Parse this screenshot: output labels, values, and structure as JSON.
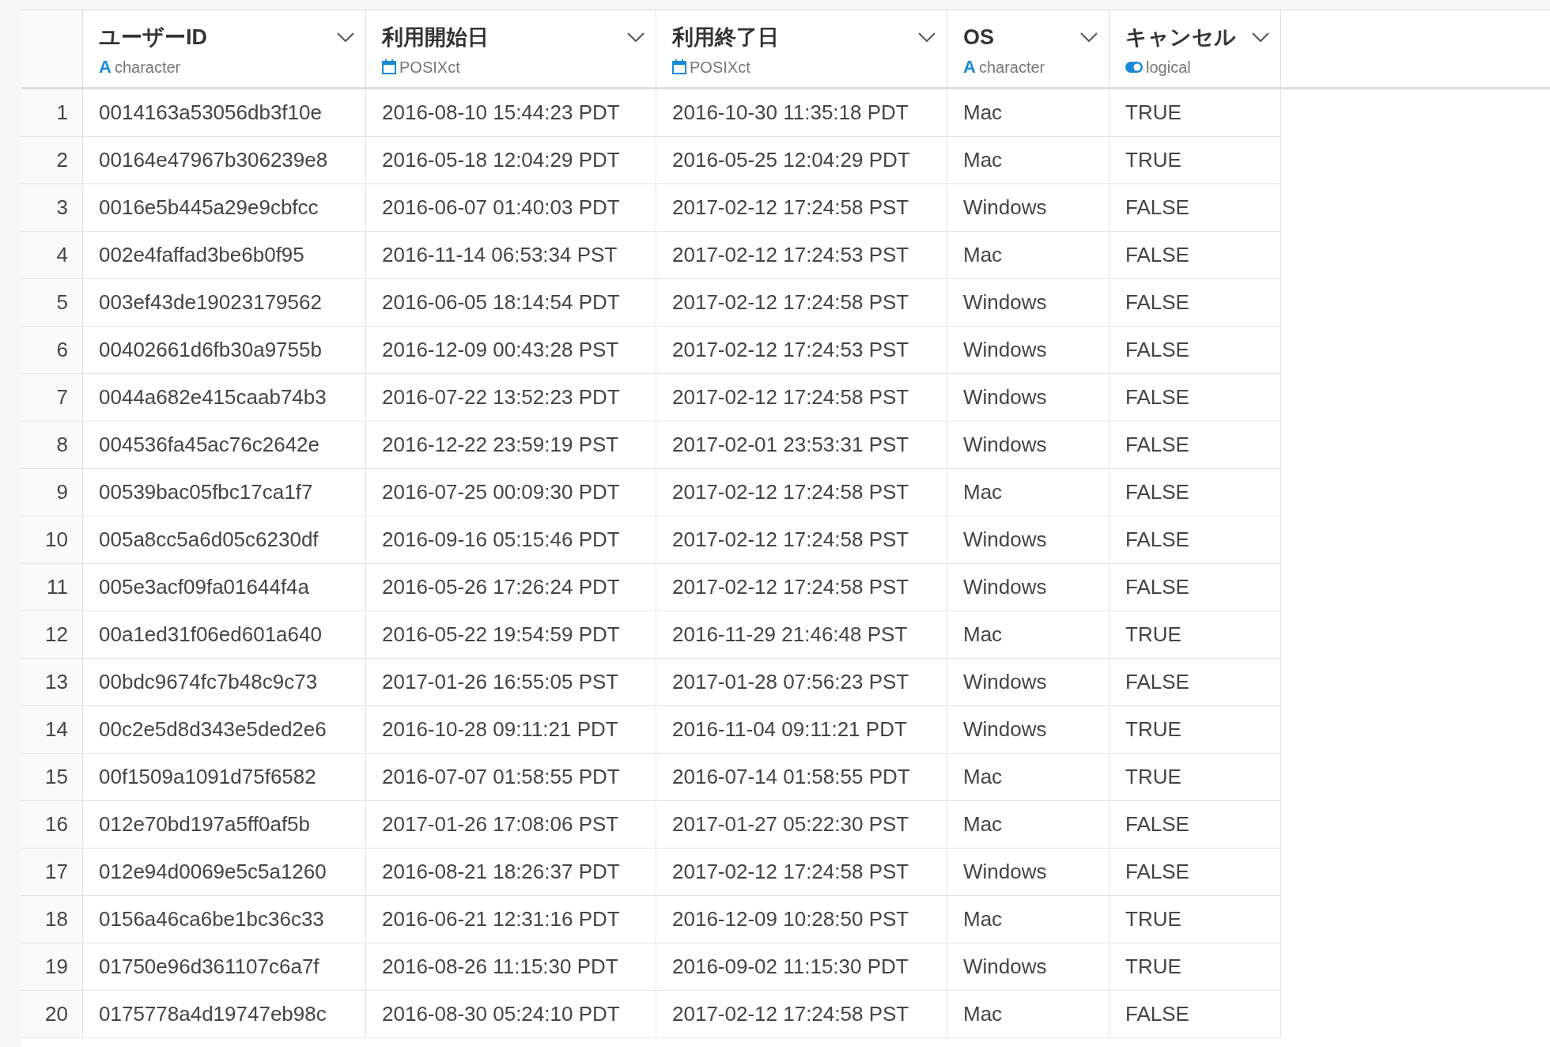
{
  "table": {
    "columns": [
      {
        "kind": "index"
      },
      {
        "label": "ユーザーID",
        "type": "character",
        "kind": "character",
        "icon_glyph": "A"
      },
      {
        "label": "利用開始日",
        "type": "POSIXct",
        "kind": "datetime"
      },
      {
        "label": "利用終了日",
        "type": "POSIXct",
        "kind": "datetime"
      },
      {
        "label": "OS",
        "type": "character",
        "kind": "character",
        "icon_glyph": "A"
      },
      {
        "label": "キャンセル",
        "type": "logical",
        "kind": "logical"
      }
    ],
    "rows": [
      [
        "1",
        "0014163a53056db3f10e",
        "2016-08-10 15:44:23 PDT",
        "2016-10-30 11:35:18 PDT",
        "Mac",
        "TRUE"
      ],
      [
        "2",
        "00164e47967b306239e8",
        "2016-05-18 12:04:29 PDT",
        "2016-05-25 12:04:29 PDT",
        "Mac",
        "TRUE"
      ],
      [
        "3",
        "0016e5b445a29e9cbfcc",
        "2016-06-07 01:40:03 PDT",
        "2017-02-12 17:24:58 PST",
        "Windows",
        "FALSE"
      ],
      [
        "4",
        "002e4faffad3be6b0f95",
        "2016-11-14 06:53:34 PST",
        "2017-02-12 17:24:53 PST",
        "Mac",
        "FALSE"
      ],
      [
        "5",
        "003ef43de19023179562",
        "2016-06-05 18:14:54 PDT",
        "2017-02-12 17:24:58 PST",
        "Windows",
        "FALSE"
      ],
      [
        "6",
        "00402661d6fb30a9755b",
        "2016-12-09 00:43:28 PST",
        "2017-02-12 17:24:53 PST",
        "Windows",
        "FALSE"
      ],
      [
        "7",
        "0044a682e415caab74b3",
        "2016-07-22 13:52:23 PDT",
        "2017-02-12 17:24:58 PST",
        "Windows",
        "FALSE"
      ],
      [
        "8",
        "004536fa45ac76c2642e",
        "2016-12-22 23:59:19 PST",
        "2017-02-01 23:53:31 PST",
        "Windows",
        "FALSE"
      ],
      [
        "9",
        "00539bac05fbc17ca1f7",
        "2016-07-25 00:09:30 PDT",
        "2017-02-12 17:24:58 PST",
        "Mac",
        "FALSE"
      ],
      [
        "10",
        "005a8cc5a6d05c6230df",
        "2016-09-16 05:15:46 PDT",
        "2017-02-12 17:24:58 PST",
        "Windows",
        "FALSE"
      ],
      [
        "11",
        "005e3acf09fa01644f4a",
        "2016-05-26 17:26:24 PDT",
        "2017-02-12 17:24:58 PST",
        "Windows",
        "FALSE"
      ],
      [
        "12",
        "00a1ed31f06ed601a640",
        "2016-05-22 19:54:59 PDT",
        "2016-11-29 21:46:48 PST",
        "Mac",
        "TRUE"
      ],
      [
        "13",
        "00bdc9674fc7b48c9c73",
        "2017-01-26 16:55:05 PST",
        "2017-01-28 07:56:23 PST",
        "Windows",
        "FALSE"
      ],
      [
        "14",
        "00c2e5d8d343e5ded2e6",
        "2016-10-28 09:11:21 PDT",
        "2016-11-04 09:11:21 PDT",
        "Windows",
        "TRUE"
      ],
      [
        "15",
        "00f1509a1091d75f6582",
        "2016-07-07 01:58:55 PDT",
        "2016-07-14 01:58:55 PDT",
        "Mac",
        "TRUE"
      ],
      [
        "16",
        "012e70bd197a5ff0af5b",
        "2017-01-26 17:08:06 PST",
        "2017-01-27 05:22:30 PST",
        "Mac",
        "FALSE"
      ],
      [
        "17",
        "012e94d0069e5c5a1260",
        "2016-08-21 18:26:37 PDT",
        "2017-02-12 17:24:58 PST",
        "Windows",
        "FALSE"
      ],
      [
        "18",
        "0156a46ca6be1bc36c33",
        "2016-06-21 12:31:16 PDT",
        "2016-12-09 10:28:50 PST",
        "Mac",
        "TRUE"
      ],
      [
        "19",
        "01750e96d361107c6a7f",
        "2016-08-26 11:15:30 PDT",
        "2016-09-02 11:15:30 PDT",
        "Windows",
        "TRUE"
      ],
      [
        "20",
        "0175778a4d19747eb98c",
        "2016-08-30 05:24:10 PDT",
        "2017-02-12 17:24:58 PST",
        "Mac",
        "FALSE"
      ]
    ]
  }
}
